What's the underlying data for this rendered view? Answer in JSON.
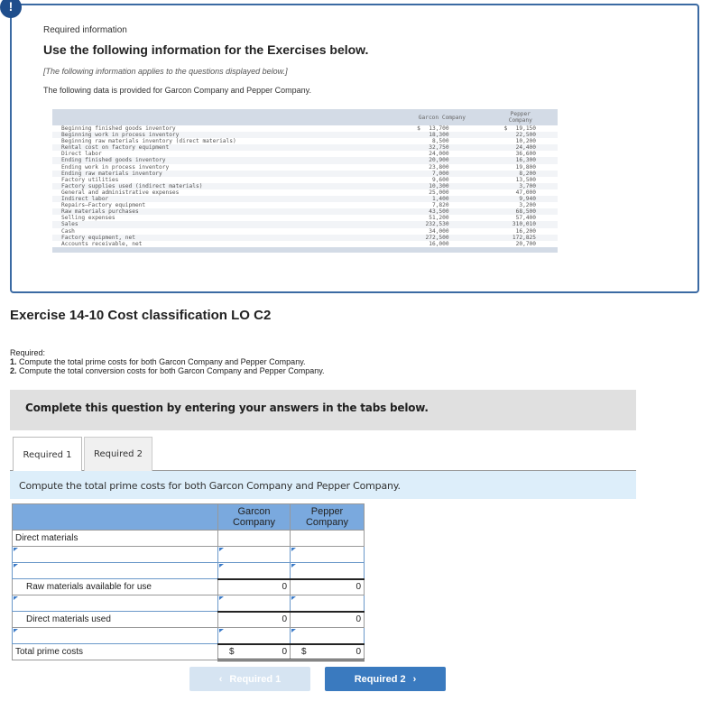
{
  "info": {
    "badge": "!",
    "required_label": "Required information",
    "title": "Use the following information for the Exercises below.",
    "applies_note": "[The following information applies to the questions displayed below.]",
    "provided_text": "The following data is provided for Garcon Company and Pepper Company.",
    "table": {
      "headers": {
        "label": "",
        "garcon": "Garcon Company",
        "pepper_line1": "Pepper",
        "pepper_line2": "Company"
      },
      "currency_symbol": "$",
      "rows": [
        {
          "label": "Beginning finished goods inventory",
          "garcon": "13,700",
          "pepper": "19,150",
          "currency": true
        },
        {
          "label": "Beginning work in process inventory",
          "garcon": "18,300",
          "pepper": "22,500"
        },
        {
          "label": "Beginning raw materials inventory (direct materials)",
          "garcon": "8,500",
          "pepper": "10,200"
        },
        {
          "label": "Rental cost on factory equipment",
          "garcon": "32,750",
          "pepper": "24,400"
        },
        {
          "label": "Direct labor",
          "garcon": "24,000",
          "pepper": "36,600"
        },
        {
          "label": "Ending finished goods inventory",
          "garcon": "20,900",
          "pepper": "16,300"
        },
        {
          "label": "Ending work in process inventory",
          "garcon": "23,800",
          "pepper": "19,800"
        },
        {
          "label": "Ending raw materials inventory",
          "garcon": "7,000",
          "pepper": "8,200"
        },
        {
          "label": "Factory utilities",
          "garcon": "9,600",
          "pepper": "13,500"
        },
        {
          "label": "Factory supplies used (indirect materials)",
          "garcon": "10,300",
          "pepper": "3,700"
        },
        {
          "label": "General and administrative expenses",
          "garcon": "25,000",
          "pepper": "47,000"
        },
        {
          "label": "Indirect labor",
          "garcon": "1,400",
          "pepper": "9,940"
        },
        {
          "label": "Repairs—Factory equipment",
          "garcon": "7,820",
          "pepper": "3,200"
        },
        {
          "label": "Raw materials purchases",
          "garcon": "43,500",
          "pepper": "68,500"
        },
        {
          "label": "Selling expenses",
          "garcon": "51,200",
          "pepper": "57,400"
        },
        {
          "label": "Sales",
          "garcon": "232,530",
          "pepper": "310,010"
        },
        {
          "label": "Cash",
          "garcon": "34,000",
          "pepper": "16,200"
        },
        {
          "label": "Factory equipment, net",
          "garcon": "272,500",
          "pepper": "172,825"
        },
        {
          "label": "Accounts receivable, net",
          "garcon": "16,000",
          "pepper": "20,700"
        }
      ]
    }
  },
  "exercise": {
    "title": "Exercise 14-10 Cost classification LO C2",
    "required_heading": "Required:",
    "required_items": [
      {
        "num": "1.",
        "text": "Compute the total prime costs for both Garcon Company and Pepper Company."
      },
      {
        "num": "2.",
        "text": "Compute the total conversion costs for both Garcon Company and Pepper Company."
      }
    ],
    "complete_text": "Complete this question by entering your answers in the tabs below."
  },
  "tabs": [
    {
      "label": "Required 1",
      "active": true
    },
    {
      "label": "Required 2",
      "active": false
    }
  ],
  "prompt": "Compute the total prime costs for both Garcon Company and Pepper Company.",
  "answer_table": {
    "headers": {
      "label": "",
      "garcon_line1": "Garcon",
      "garcon_line2": "Company",
      "pepper_line1": "Pepper",
      "pepper_line2": "Company"
    },
    "currency_symbol": "$",
    "rows": {
      "direct_materials": {
        "label": "Direct materials"
      },
      "input_1": {
        "label": "",
        "garcon": "",
        "pepper": ""
      },
      "input_2": {
        "label": "",
        "garcon": "",
        "pepper": ""
      },
      "raw_available": {
        "label": "Raw materials available for use",
        "garcon": "0",
        "pepper": "0"
      },
      "input_3": {
        "label": "",
        "garcon": "",
        "pepper": ""
      },
      "dm_used": {
        "label": "Direct materials used",
        "garcon": "0",
        "pepper": "0"
      },
      "input_4": {
        "label": "",
        "garcon": "",
        "pepper": ""
      },
      "total": {
        "label": "Total prime costs",
        "garcon": "0",
        "pepper": "0"
      }
    }
  },
  "nav": {
    "prev_label": "Required 1",
    "prev_icon": "‹",
    "next_label": "Required 2",
    "next_icon": "›"
  }
}
